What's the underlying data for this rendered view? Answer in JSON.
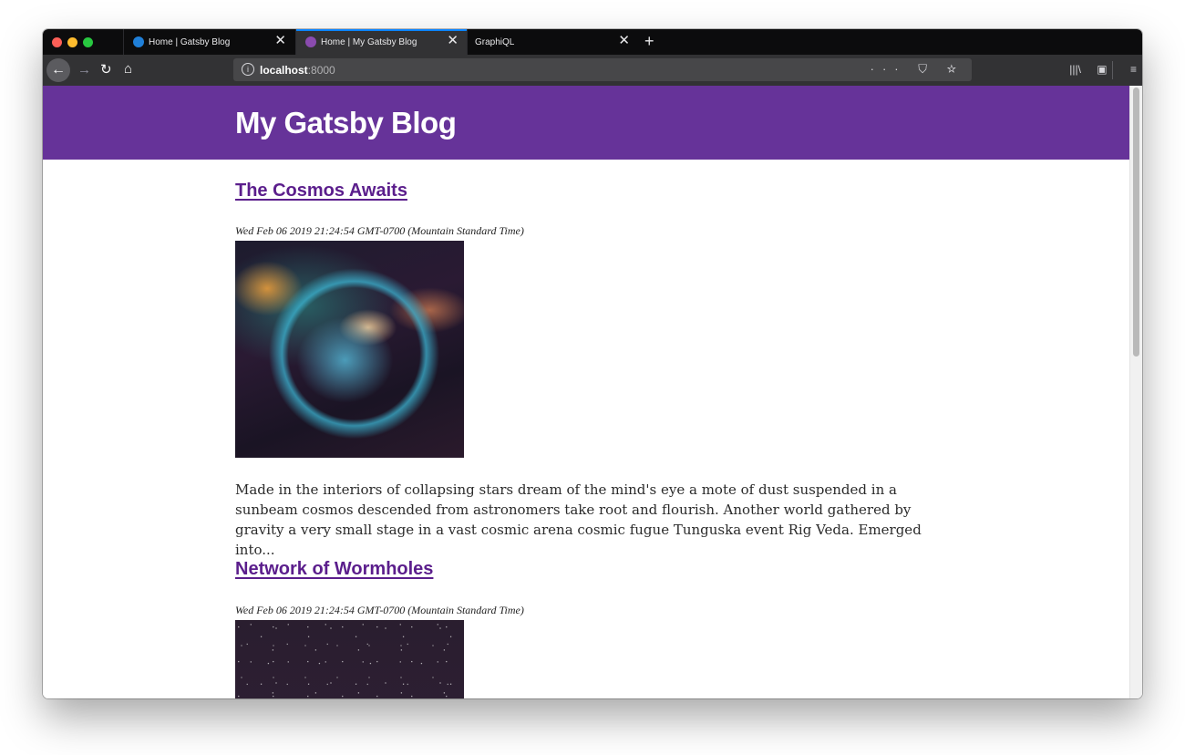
{
  "browser": {
    "tabs": [
      {
        "label": "Home | Gatsby Blog",
        "close": "✕",
        "favicon_color": "#1f7fd8"
      },
      {
        "label": "Home | My Gatsby Blog",
        "close": "✕",
        "favicon_color": "#8a4baf"
      },
      {
        "label": "GraphiQL",
        "close": "✕"
      }
    ],
    "new_tab": "+",
    "url_host": "localhost",
    "url_port": ":8000",
    "url_actions": "··· ⛉ ☆",
    "accent": "#0a84ff"
  },
  "site": {
    "title": "My Gatsby Blog",
    "header_color": "#663399"
  },
  "posts": [
    {
      "title": "The Cosmos Awaits",
      "date": "Wed Feb 06 2019 21:24:54 GMT-0700 (Mountain Standard Time)",
      "excerpt": "Made in the interiors of collapsing stars dream of the mind's eye a mote of dust suspended in a sunbeam cosmos descended from astronomers take root and flourish. Another world gathered by gravity a very small stage in a vast cosmic arena cosmic fugue Tunguska event Rig Veda. Emerged into..."
    },
    {
      "title": "Network of Wormholes",
      "date": "Wed Feb 06 2019 21:24:54 GMT-0700 (Mountain Standard Time)"
    }
  ]
}
